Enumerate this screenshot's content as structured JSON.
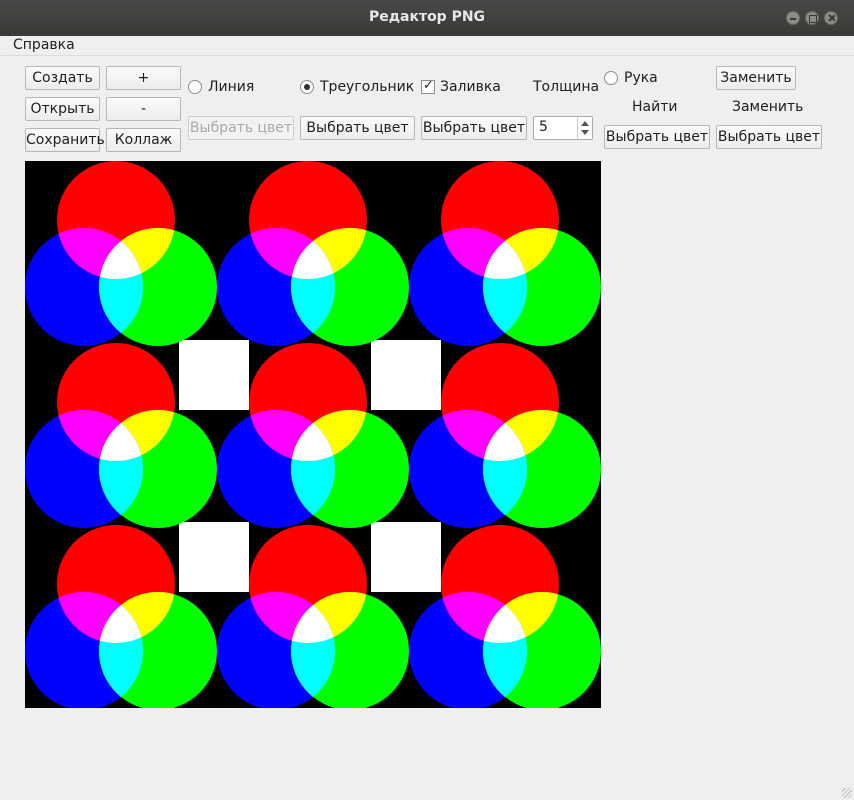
{
  "window": {
    "title": "Редактор PNG"
  },
  "menu": {
    "help": "Справка"
  },
  "toolbar": {
    "create": "Создать",
    "zoom_in": "+",
    "open": "Открыть",
    "zoom_out": "-",
    "save": "Сохранить",
    "collage": "Коллаж",
    "line_label": "Линия",
    "triangle_label": "Треугольник",
    "fill_label": "Заливка",
    "thickness_label": "Толщина",
    "thickness_value": "5",
    "hand_label": "Рука",
    "replace_button": "Заменить",
    "find_label": "Найти",
    "replace_label": "Заменить",
    "choose_color": "Выбрать цвет",
    "line_checked": false,
    "triangle_checked": true,
    "fill_checked": true,
    "hand_checked": false,
    "line_color_enabled": false
  },
  "image": {
    "grid_rows": 3,
    "grid_cols": 3,
    "background": "#000000",
    "colors": {
      "red": "#ff0000",
      "green": "#00ff00",
      "blue": "#0000ff",
      "yellow": "#ffff00",
      "magenta": "#ff00ff",
      "cyan": "#00ffff",
      "white": "#ffffff"
    },
    "white_squares": 4
  }
}
